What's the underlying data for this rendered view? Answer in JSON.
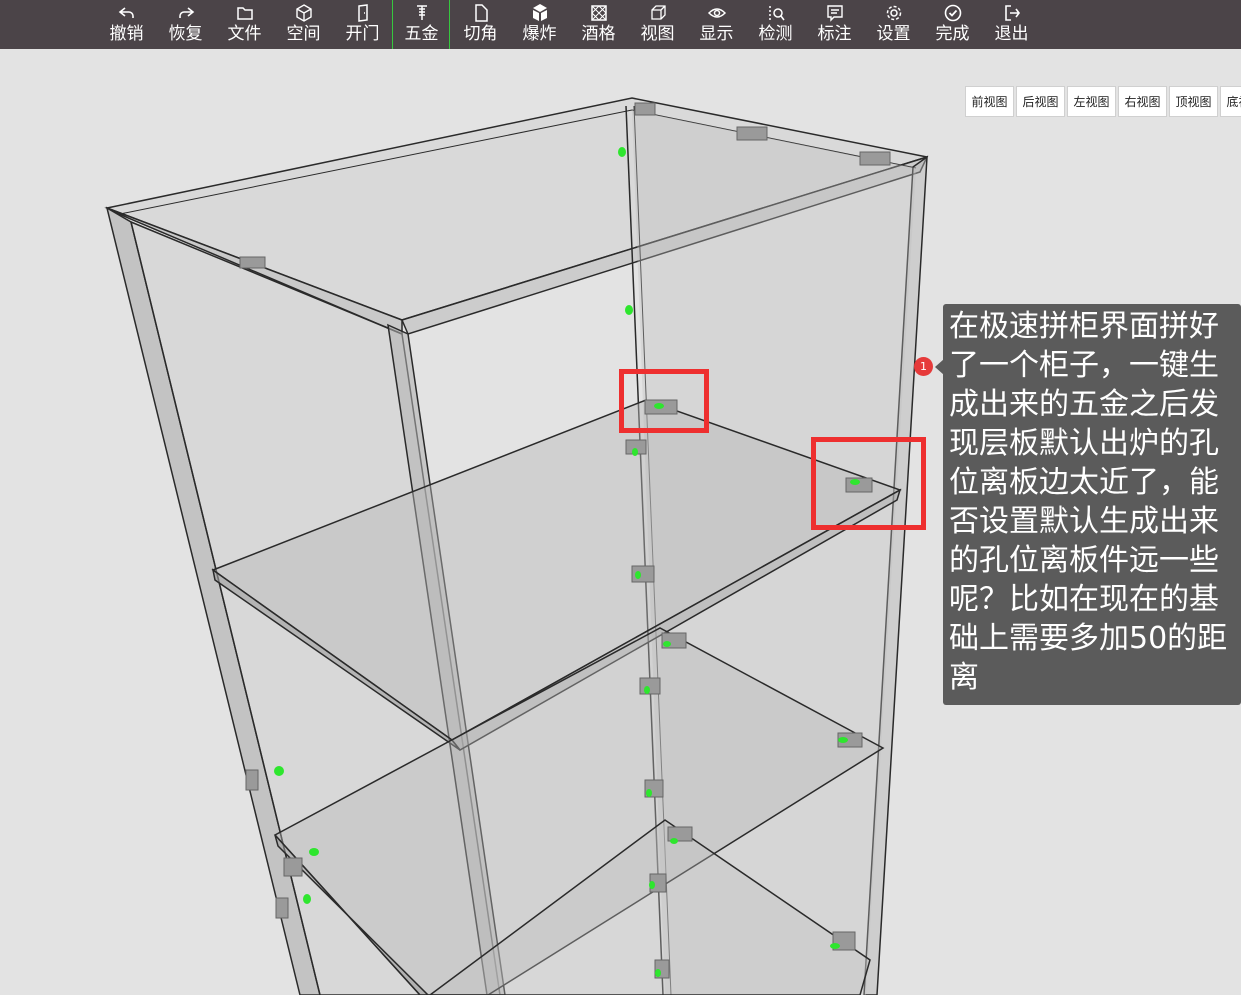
{
  "toolbar": {
    "items": [
      {
        "label": "撤销",
        "icon": "undo-icon"
      },
      {
        "label": "恢复",
        "icon": "redo-icon"
      },
      {
        "label": "文件",
        "icon": "folder-icon"
      },
      {
        "label": "空间",
        "icon": "cube-icon"
      },
      {
        "label": "开门",
        "icon": "door-icon"
      },
      {
        "label": "五金",
        "icon": "screw-icon"
      },
      {
        "label": "切角",
        "icon": "corner-cut-icon"
      },
      {
        "label": "爆炸",
        "icon": "explode-cube-icon"
      },
      {
        "label": "酒格",
        "icon": "wine-grid-icon"
      },
      {
        "label": "视图",
        "icon": "view-cube-icon"
      },
      {
        "label": "显示",
        "icon": "eye-icon"
      },
      {
        "label": "检测",
        "icon": "inspect-list-icon"
      },
      {
        "label": "标注",
        "icon": "annotation-icon"
      },
      {
        "label": "设置",
        "icon": "gear-icon"
      },
      {
        "label": "完成",
        "icon": "check-circle-icon"
      },
      {
        "label": "退出",
        "icon": "exit-icon"
      }
    ],
    "active_item": "五金",
    "colors": {
      "background": "#4b4448",
      "active_separator": "#36c83e"
    }
  },
  "view_buttons": [
    "前视图",
    "后视图",
    "左视图",
    "右视图",
    "顶视图",
    "底视图"
  ],
  "annotation": {
    "marker": "1",
    "comment": "在极速拼柜界面拼好了一个柜子，一键生成出来的五金之后发现层板默认出炉的孔位离板边太近了，能否设置默认生成出来的孔位离板件远一些呢？比如在现在的基础上需要多加50的距离",
    "colors": {
      "tooltip_bg": "#5b5b5b",
      "marker": "#e63a3a",
      "highlight": "#ee2f2f",
      "hole": "#2ee62e"
    }
  }
}
